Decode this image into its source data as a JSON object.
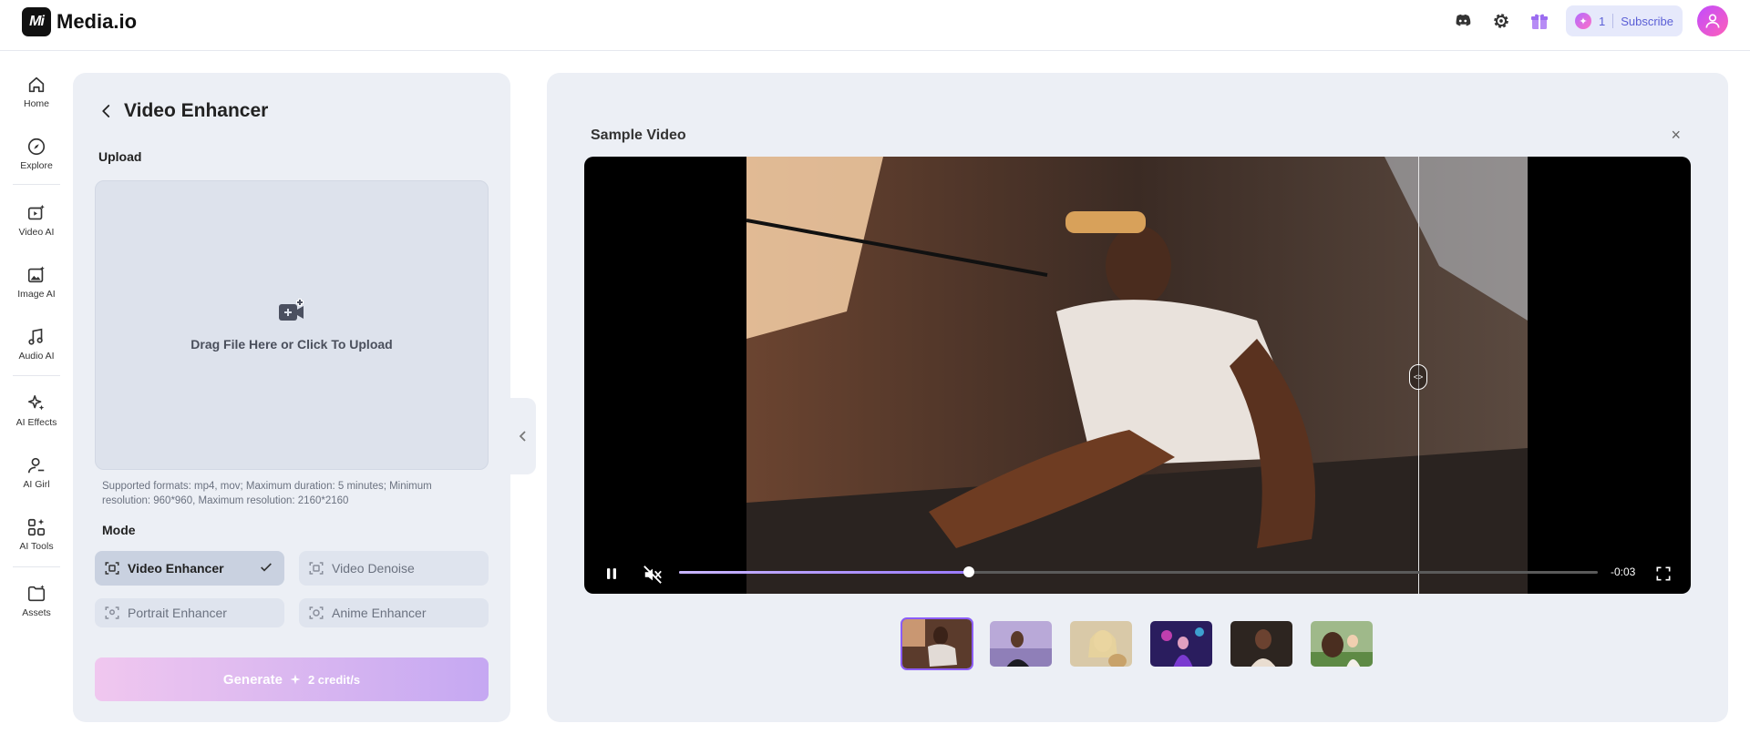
{
  "app": {
    "name": "Media.io"
  },
  "header": {
    "credits": "1",
    "subscribe_label": "Subscribe"
  },
  "sidebar": {
    "items": [
      {
        "label": "Home",
        "icon": "home-icon"
      },
      {
        "label": "Explore",
        "icon": "compass-icon"
      },
      {
        "label": "Video AI",
        "icon": "video-ai-icon"
      },
      {
        "label": "Image AI",
        "icon": "image-ai-icon"
      },
      {
        "label": "Audio AI",
        "icon": "audio-ai-icon"
      },
      {
        "label": "AI Effects",
        "icon": "sparkle-icon"
      },
      {
        "label": "AI Girl",
        "icon": "user-icon"
      },
      {
        "label": "AI Tools",
        "icon": "tools-icon"
      },
      {
        "label": "Assets",
        "icon": "folder-icon"
      }
    ]
  },
  "left_panel": {
    "title": "Video Enhancer",
    "upload_section": "Upload",
    "upload_text": "Drag File Here or Click To Upload",
    "formats_text": "Supported formats: mp4, mov; Maximum duration: 5 minutes; Minimum resolution: 960*960, Maximum resolution: 2160*2160",
    "mode_section": "Mode",
    "modes": [
      {
        "label": "Video Enhancer",
        "selected": true
      },
      {
        "label": "Video Denoise",
        "selected": false
      },
      {
        "label": "Portrait Enhancer",
        "selected": false
      },
      {
        "label": "Anime Enhancer",
        "selected": false
      }
    ],
    "generate_label": "Generate",
    "generate_credits": "2 credit/s"
  },
  "preview": {
    "title": "Sample Video",
    "close_label": "×",
    "time": "-0:03",
    "progress_fraction": 0.315,
    "playing": true,
    "muted": true,
    "thumbnails_count": 6,
    "selected_thumbnail": 0
  },
  "colors": {
    "accent": "#8b5cf6",
    "panel": "#eceff5"
  }
}
